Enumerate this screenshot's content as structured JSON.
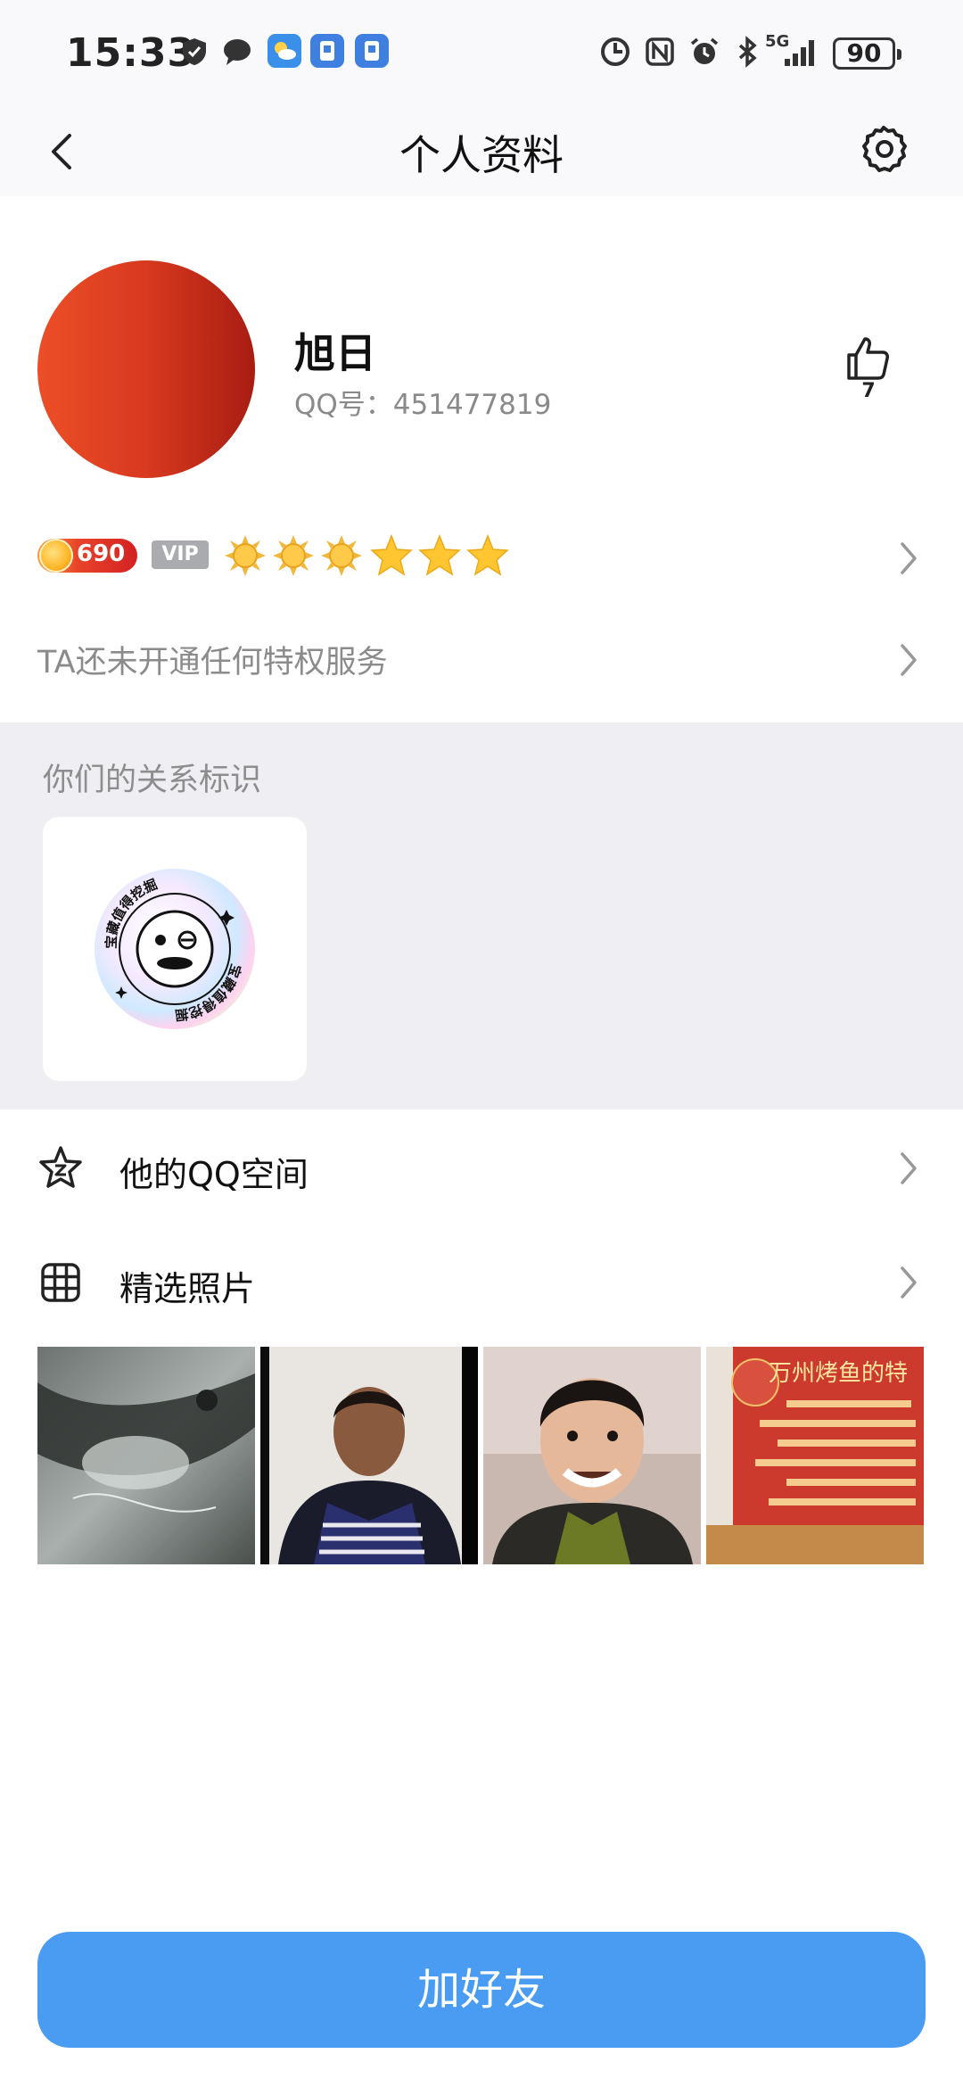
{
  "status_bar": {
    "time": "15:33",
    "battery": "90",
    "network": "5G",
    "icons": [
      "shield-icon",
      "chat-bubble-icon",
      "weather-icon",
      "app-notification-icon",
      "app-notification-icon",
      "data-saver-icon",
      "nfc-icon",
      "alarm-icon",
      "bluetooth-icon",
      "signal-icon",
      "battery-icon"
    ]
  },
  "nav": {
    "title": "个人资料",
    "back_icon": "chevron-left-icon",
    "settings_icon": "gear-icon"
  },
  "profile": {
    "name": "旭日",
    "qq_number": "QQ号：451477819",
    "likes": "7",
    "avatar_color": "#e03a20"
  },
  "level": {
    "level_value": "690",
    "vip_label": "VIP",
    "suns": 3,
    "stars": 3
  },
  "privilege": {
    "text": "TA还未开通任何特权服务"
  },
  "relationship": {
    "title": "你们的关系标识",
    "sticker_text": "宝藏值得挖掘"
  },
  "menu": {
    "qzone_label": "他的QQ空间",
    "photos_label": "精选照片"
  },
  "photos": [
    {
      "name": "photo-cave"
    },
    {
      "name": "photo-man"
    },
    {
      "name": "photo-child"
    },
    {
      "name": "photo-sign",
      "text": "万州烤鱼的特"
    }
  ],
  "actions": {
    "add_friend": "加好友"
  },
  "colors": {
    "accent": "#4a9bf2",
    "section_bg": "#efeff3",
    "secondary_text": "#8b8b8b"
  }
}
